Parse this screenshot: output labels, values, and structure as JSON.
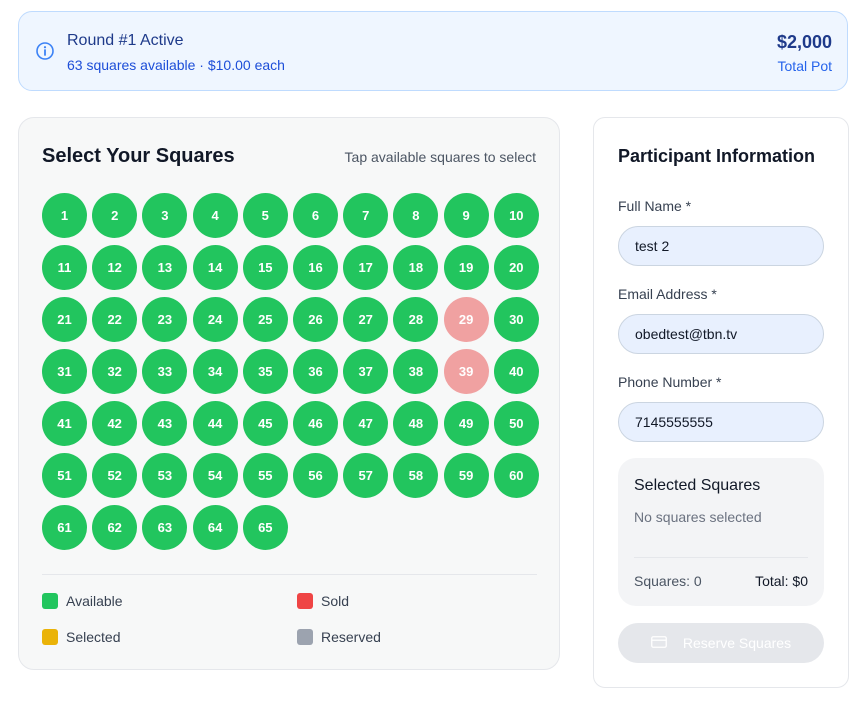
{
  "banner": {
    "title": "Round #1 Active",
    "subtitle": "63 squares available · $10.00 each",
    "pot_amount": "$2,000",
    "pot_label": "Total Pot",
    "icon": "info-icon"
  },
  "grid": {
    "heading": "Select Your Squares",
    "hint": "Tap available squares to select",
    "squares": [
      {
        "n": "1",
        "s": "available"
      },
      {
        "n": "2",
        "s": "available"
      },
      {
        "n": "3",
        "s": "available"
      },
      {
        "n": "4",
        "s": "available"
      },
      {
        "n": "5",
        "s": "available"
      },
      {
        "n": "6",
        "s": "available"
      },
      {
        "n": "7",
        "s": "available"
      },
      {
        "n": "8",
        "s": "available"
      },
      {
        "n": "9",
        "s": "available"
      },
      {
        "n": "10",
        "s": "available"
      },
      {
        "n": "11",
        "s": "available"
      },
      {
        "n": "12",
        "s": "available"
      },
      {
        "n": "13",
        "s": "available"
      },
      {
        "n": "14",
        "s": "available"
      },
      {
        "n": "15",
        "s": "available"
      },
      {
        "n": "16",
        "s": "available"
      },
      {
        "n": "17",
        "s": "available"
      },
      {
        "n": "18",
        "s": "available"
      },
      {
        "n": "19",
        "s": "available"
      },
      {
        "n": "20",
        "s": "available"
      },
      {
        "n": "21",
        "s": "available"
      },
      {
        "n": "22",
        "s": "available"
      },
      {
        "n": "23",
        "s": "available"
      },
      {
        "n": "24",
        "s": "available"
      },
      {
        "n": "25",
        "s": "available"
      },
      {
        "n": "26",
        "s": "available"
      },
      {
        "n": "27",
        "s": "available"
      },
      {
        "n": "28",
        "s": "available"
      },
      {
        "n": "29",
        "s": "sold"
      },
      {
        "n": "30",
        "s": "available"
      },
      {
        "n": "31",
        "s": "available"
      },
      {
        "n": "32",
        "s": "available"
      },
      {
        "n": "33",
        "s": "available"
      },
      {
        "n": "34",
        "s": "available"
      },
      {
        "n": "35",
        "s": "available"
      },
      {
        "n": "36",
        "s": "available"
      },
      {
        "n": "37",
        "s": "available"
      },
      {
        "n": "38",
        "s": "available"
      },
      {
        "n": "39",
        "s": "sold"
      },
      {
        "n": "40",
        "s": "available"
      },
      {
        "n": "41",
        "s": "available"
      },
      {
        "n": "42",
        "s": "available"
      },
      {
        "n": "43",
        "s": "available"
      },
      {
        "n": "44",
        "s": "available"
      },
      {
        "n": "45",
        "s": "available"
      },
      {
        "n": "46",
        "s": "available"
      },
      {
        "n": "47",
        "s": "available"
      },
      {
        "n": "48",
        "s": "available"
      },
      {
        "n": "49",
        "s": "available"
      },
      {
        "n": "50",
        "s": "available"
      },
      {
        "n": "51",
        "s": "available"
      },
      {
        "n": "52",
        "s": "available"
      },
      {
        "n": "53",
        "s": "available"
      },
      {
        "n": "54",
        "s": "available"
      },
      {
        "n": "55",
        "s": "available"
      },
      {
        "n": "56",
        "s": "available"
      },
      {
        "n": "57",
        "s": "available"
      },
      {
        "n": "58",
        "s": "available"
      },
      {
        "n": "59",
        "s": "available"
      },
      {
        "n": "60",
        "s": "available"
      },
      {
        "n": "61",
        "s": "available"
      },
      {
        "n": "62",
        "s": "available"
      },
      {
        "n": "63",
        "s": "available"
      },
      {
        "n": "64",
        "s": "available"
      },
      {
        "n": "65",
        "s": "available"
      }
    ],
    "legend": {
      "available": {
        "label": "Available",
        "color": "#22c55e"
      },
      "sold": {
        "label": "Sold",
        "color": "#ef4444"
      },
      "selected": {
        "label": "Selected",
        "color": "#eab308"
      },
      "reserved": {
        "label": "Reserved",
        "color": "#9ca3af"
      }
    }
  },
  "form": {
    "heading": "Participant Information",
    "name_label": "Full Name *",
    "name_value": "test 2",
    "email_label": "Email Address *",
    "email_value": "obedtest@tbn.tv",
    "phone_label": "Phone Number *",
    "phone_value": "7145555555",
    "selected": {
      "title": "Selected Squares",
      "empty_text": "No squares selected",
      "count_text": "Squares: 0",
      "total_text": "Total: $0"
    },
    "reserve_label": "Reserve Squares",
    "reserve_icon": "credit-card-icon"
  }
}
